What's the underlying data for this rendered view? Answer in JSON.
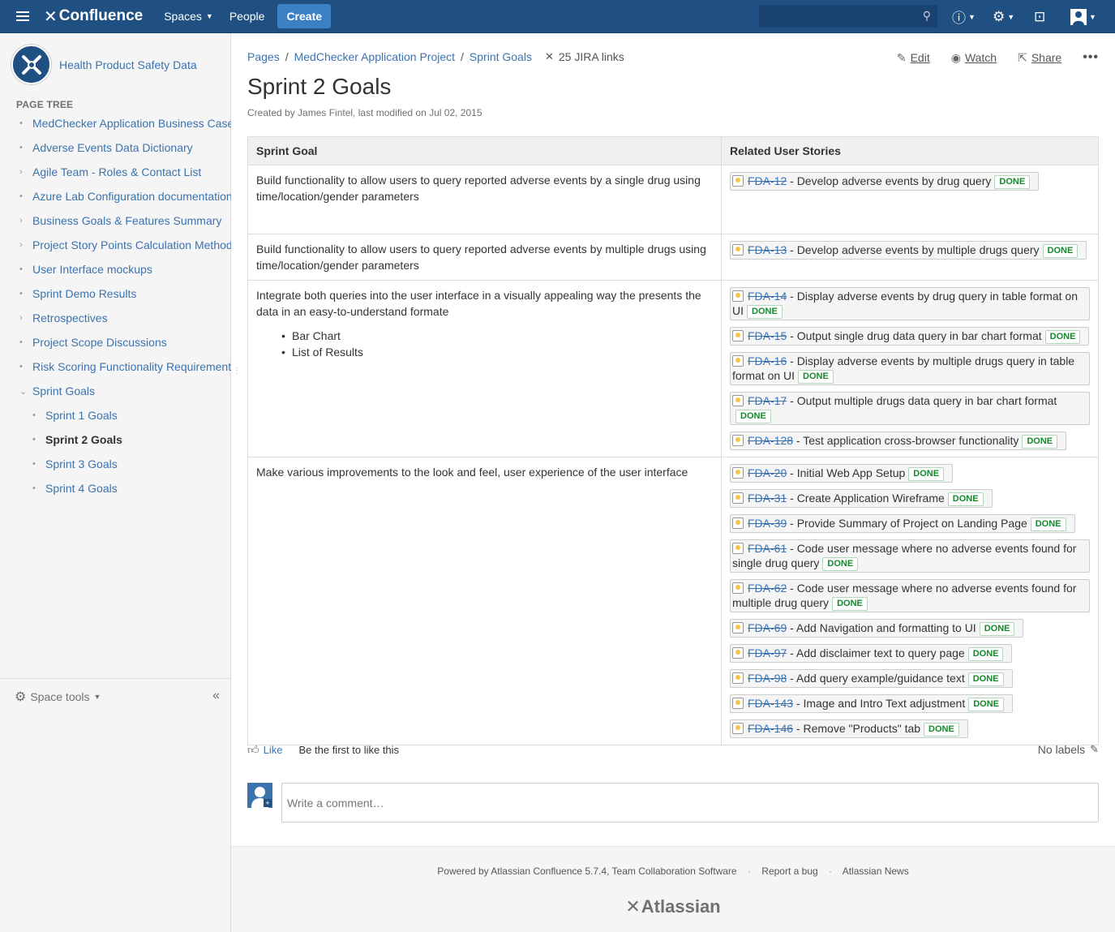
{
  "header": {
    "app_name": "Confluence",
    "spaces_label": "Spaces",
    "people_label": "People",
    "create_label": "Create",
    "search_placeholder": ""
  },
  "sidebar": {
    "space_name": "Health Product Safety Data",
    "tree_title": "PAGE TREE",
    "items": [
      {
        "label": "MedChecker Application Business Case",
        "mark": "•",
        "level": 0
      },
      {
        "label": "Adverse Events Data Dictionary",
        "mark": "•",
        "level": 0
      },
      {
        "label": "Agile Team - Roles & Contact List",
        "mark": "›",
        "level": 0
      },
      {
        "label": "Azure Lab Configuration documentation",
        "mark": "•",
        "level": 0
      },
      {
        "label": "Business Goals & Features Summary",
        "mark": "›",
        "level": 0
      },
      {
        "label": "Project Story Points Calculation Method",
        "mark": "›",
        "level": 0
      },
      {
        "label": "User Interface mockups",
        "mark": "•",
        "level": 0
      },
      {
        "label": "Sprint Demo Results",
        "mark": "•",
        "level": 0
      },
      {
        "label": "Retrospectives",
        "mark": "›",
        "level": 0
      },
      {
        "label": "Project Scope Discussions",
        "mark": "•",
        "level": 0
      },
      {
        "label": "Risk Scoring Functionality Requirements",
        "mark": "•",
        "level": 0
      },
      {
        "label": "Sprint Goals",
        "mark": "⌄",
        "level": 0
      },
      {
        "label": "Sprint 1 Goals",
        "mark": "•",
        "level": 1
      },
      {
        "label": "Sprint 2 Goals",
        "mark": "•",
        "level": 1,
        "current": true
      },
      {
        "label": "Sprint 3 Goals",
        "mark": "•",
        "level": 1
      },
      {
        "label": "Sprint 4 Goals",
        "mark": "•",
        "level": 1
      }
    ],
    "space_tools_label": "Space tools"
  },
  "breadcrumbs": [
    "Pages",
    "MedChecker Application Project",
    "Sprint Goals"
  ],
  "jira_links_label": "25 JIRA links",
  "actions": {
    "edit": "Edit",
    "watch": "Watch",
    "share": "Share"
  },
  "page": {
    "title": "Sprint 2 Goals",
    "byline": "Created by James Fintel, last modified on Jul 02, 2015"
  },
  "table": {
    "headers": [
      "Sprint Goal",
      "Related User Stories"
    ],
    "rows": [
      {
        "goal": "Build functionality to allow users to query reported adverse events by a single drug using time/location/gender parameters",
        "bullets": [],
        "height": 85,
        "stories": [
          {
            "key": "FDA-12",
            "summary": "Develop adverse events by drug query",
            "status": "DONE"
          }
        ]
      },
      {
        "goal": "Build functionality to allow users to query reported adverse events by multiple drugs using time/location/gender parameters",
        "bullets": [],
        "height": 55,
        "stories": [
          {
            "key": "FDA-13",
            "summary": "Develop adverse events by multiple drugs query",
            "status": "DONE"
          }
        ]
      },
      {
        "goal": "Integrate both queries into the user interface in a visually appealing way the presents the data in an easy-to-understand formate",
        "bullets": [
          "Bar Chart",
          "List of Results"
        ],
        "height": 209,
        "stories": [
          {
            "key": "FDA-14",
            "summary": "Display adverse events by drug query in table format on UI",
            "status": "DONE"
          },
          {
            "key": "FDA-15",
            "summary": "Output single drug data query in bar chart format",
            "status": "DONE"
          },
          {
            "key": "FDA-16",
            "summary": "Display adverse events by multiple drugs query in table format on UI",
            "status": "DONE"
          },
          {
            "key": "FDA-17",
            "summary": "Output multiple drugs data query in bar chart format",
            "status": "DONE"
          },
          {
            "key": "FDA-128",
            "summary": "Test application cross-browser functionality",
            "status": "DONE"
          }
        ]
      },
      {
        "goal": "Make various improvements to the look and feel, user experience of the user interface",
        "bullets": [],
        "height": 340,
        "stories": [
          {
            "key": "FDA-20",
            "summary": "Initial Web App Setup",
            "status": "DONE"
          },
          {
            "key": "FDA-31",
            "summary": "Create Application Wireframe",
            "status": "DONE"
          },
          {
            "key": "FDA-39",
            "summary": "Provide Summary of Project on Landing Page",
            "status": "DONE"
          },
          {
            "key": "FDA-61",
            "summary": "Code user message where no adverse events found for single drug query",
            "status": "DONE"
          },
          {
            "key": "FDA-62",
            "summary": "Code user message where no adverse events found for multiple drug query",
            "status": "DONE"
          },
          {
            "key": "FDA-69",
            "summary": "Add Navigation and formatting to UI",
            "status": "DONE"
          },
          {
            "key": "FDA-97",
            "summary": "Add disclaimer text to query page",
            "status": "DONE"
          },
          {
            "key": "FDA-98",
            "summary": "Add query example/guidance text",
            "status": "DONE"
          },
          {
            "key": "FDA-143",
            "summary": "Image and Intro Text adjustment",
            "status": "DONE"
          },
          {
            "key": "FDA-146",
            "summary": "Remove \"Products\" tab",
            "status": "DONE"
          }
        ]
      }
    ]
  },
  "likes": {
    "like_label": "Like",
    "first_label": "Be the first to like this",
    "labels_label": "No labels"
  },
  "comment": {
    "placeholder": "Write a comment…"
  },
  "footer": {
    "powered": "Powered by Atlassian Confluence 5.7.4, Team Collaboration Software",
    "report_bug": "Report a bug",
    "news": "Atlassian News",
    "logo_text": "Atlassian"
  }
}
